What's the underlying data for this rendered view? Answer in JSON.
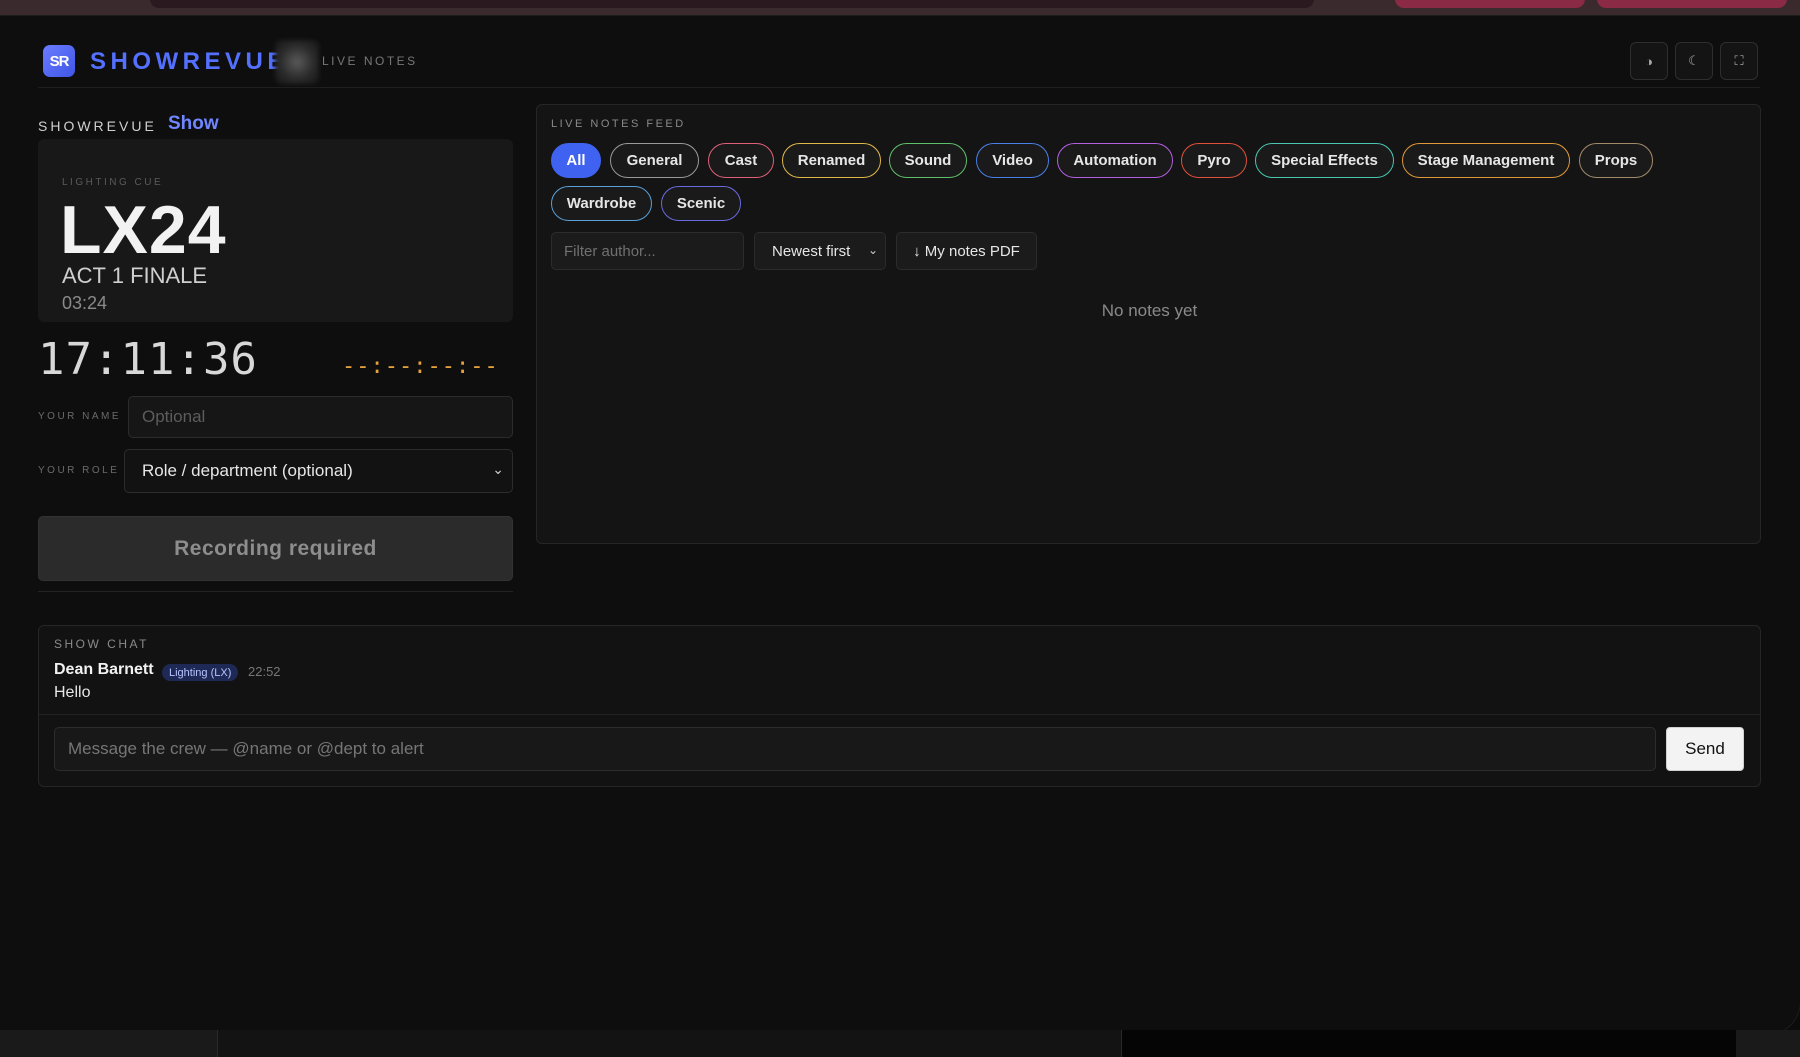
{
  "header": {
    "logo_text": "SR",
    "brand": "SHOWREVUE",
    "tag": "LIVE NOTES",
    "buttons": {
      "contrast_icon": "◑",
      "theme_icon": "☾",
      "fullscreen_icon": "⛶"
    }
  },
  "show": {
    "label": "SHOWREVUE",
    "link": "Show"
  },
  "cue": {
    "kind": "LIGHTING CUE",
    "number": "LX24",
    "name": "ACT 1 FINALE",
    "time": "03:24"
  },
  "clock": "17:11:36",
  "countdown": "--:--:--:--",
  "form": {
    "name_label": "YOUR NAME",
    "name_placeholder": "Optional",
    "role_label": "YOUR ROLE",
    "role_value": "Role / department (optional)",
    "record_button": "Recording required"
  },
  "feed": {
    "title": "LIVE NOTES FEED",
    "filters": [
      {
        "label": "All",
        "color": "#3f63f0",
        "active": true
      },
      {
        "label": "General",
        "color": "#9a9a9a"
      },
      {
        "label": "Cast",
        "color": "#e0607a"
      },
      {
        "label": "Renamed",
        "color": "#e0b84a"
      },
      {
        "label": "Sound",
        "color": "#5ec06a"
      },
      {
        "label": "Video",
        "color": "#4a7fe8"
      },
      {
        "label": "Automation",
        "color": "#b45ee0"
      },
      {
        "label": "Pyro",
        "color": "#e0503a"
      },
      {
        "label": "Special Effects",
        "color": "#4ac6b0"
      },
      {
        "label": "Stage Management",
        "color": "#e0983a"
      },
      {
        "label": "Props",
        "color": "#a08a6a"
      },
      {
        "label": "Wardrobe",
        "color": "#5aa0d8"
      },
      {
        "label": "Scenic",
        "color": "#6a6ae0"
      }
    ],
    "author_placeholder": "Filter author...",
    "sort_value": "Newest first",
    "pdf_button": "↓ My notes PDF",
    "empty_text": "No notes yet"
  },
  "chat": {
    "title": "SHOW CHAT",
    "messages": [
      {
        "author": "Dean Barnett",
        "role": "Lighting (LX)",
        "time": "22:52",
        "text": "Hello"
      }
    ],
    "input_placeholder": "Message the crew — @name or @dept to alert",
    "send_button": "Send"
  }
}
